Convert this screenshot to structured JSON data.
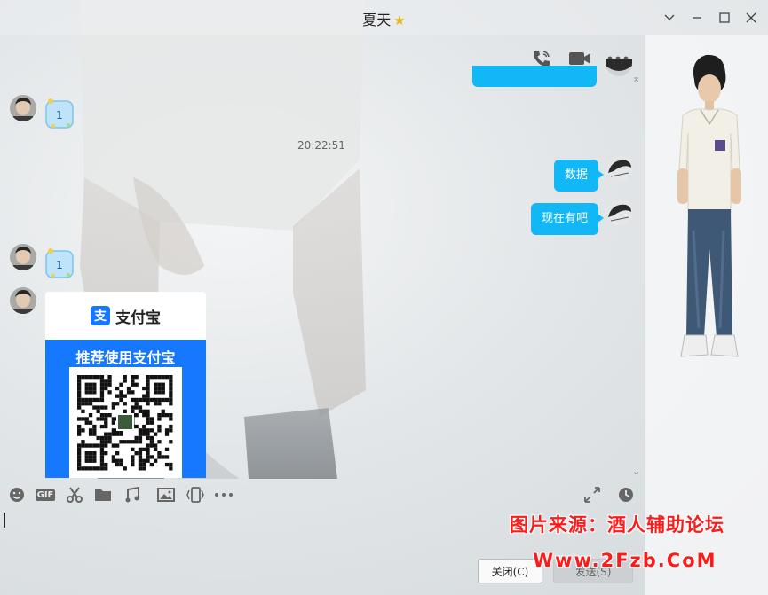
{
  "window": {
    "title": "夏天",
    "title_badge_icon": "star-icon"
  },
  "chat_toolbar": {
    "icons": [
      "voice-call-icon",
      "video-call-icon",
      "more-icon"
    ]
  },
  "messages": {
    "timestamp": "20:22:51",
    "sticker_label": "1",
    "sticker_label_2": "1",
    "outgoing_1": "数据",
    "outgoing_2": "现在有吧"
  },
  "alipay_card": {
    "brand": "支付宝",
    "logo_char": "支",
    "slogan": "推荐使用支付宝"
  },
  "input_toolbar": {
    "icons": [
      "emoji-icon",
      "gif-icon",
      "scissors-icon",
      "folder-icon",
      "music-icon",
      "image-icon",
      "shake-icon",
      "more-icon",
      "expand-icon",
      "history-icon"
    ],
    "gif_label": "GIF"
  },
  "buttons": {
    "close_label": "关闭(C)",
    "send_label": "发送(S)"
  },
  "watermark": {
    "line1": "图片来源：酒人辅助论坛",
    "line2": "Www.2Fzb.CoM"
  },
  "colors": {
    "bubble": "#12b7f5",
    "alipay_blue": "#1677ff",
    "watermark": "#ff1a1a"
  }
}
